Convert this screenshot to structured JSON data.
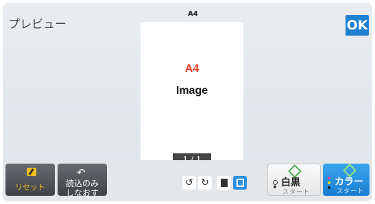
{
  "header": {
    "title": "プレビュー",
    "ok_label": "OK"
  },
  "preview": {
    "paper_size": "A4",
    "page_label": "A4",
    "page_text": "Image",
    "page_counter": "1 / 1"
  },
  "toolbar": {
    "reset_label": "リセット",
    "reread_label_1": "読込のみ",
    "reread_label_2": "しなおす",
    "rotate_left_icon": "rotate-left-icon",
    "rotate_right_icon": "rotate-right-icon",
    "single_view_icon": "single-page-icon",
    "multi_view_icon": "multi-page-icon",
    "bw_label": "白黒",
    "bw_sub": "スタート",
    "color_label": "カラー",
    "color_sub": "スタート"
  },
  "colors": {
    "accent": "#1f7fd0",
    "reset": "#f2c11a",
    "doc_label": "#e03a23"
  }
}
